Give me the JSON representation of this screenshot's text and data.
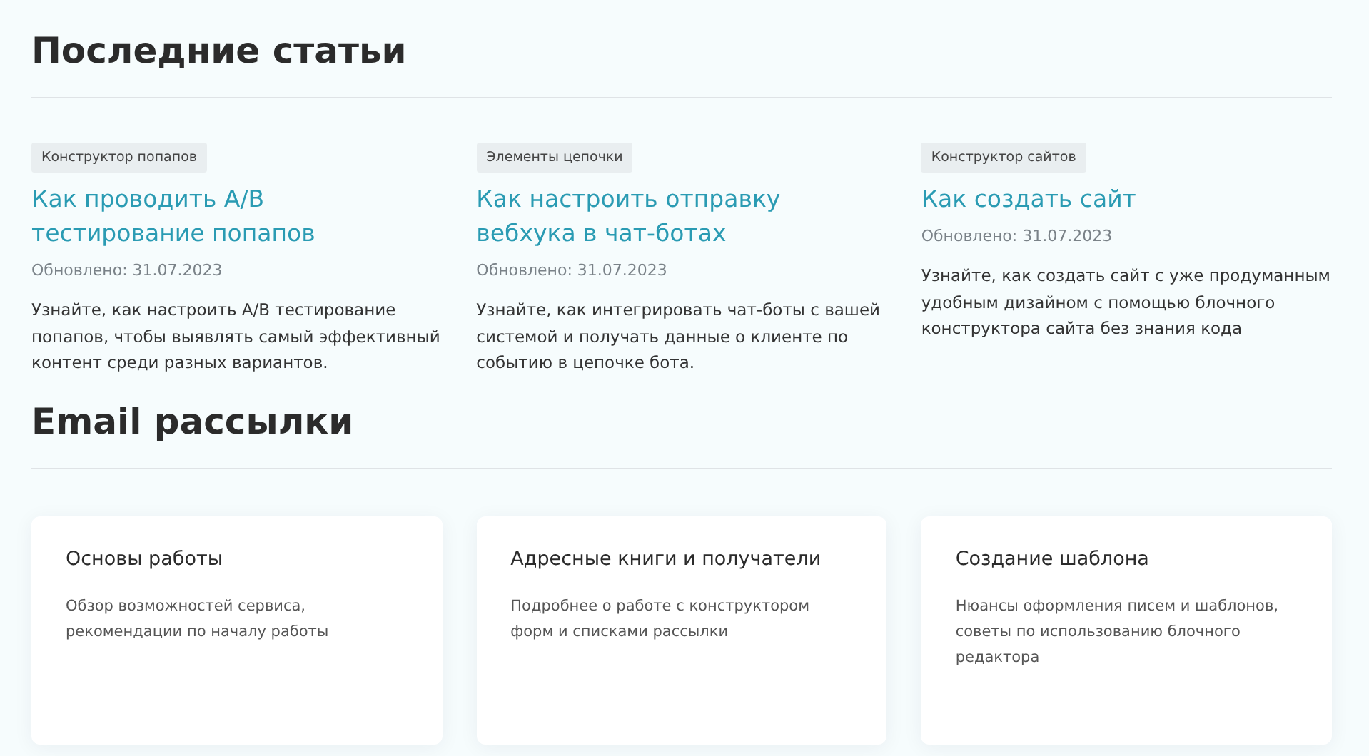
{
  "sections": [
    {
      "title": "Последние статьи",
      "kind": "articles",
      "articles": [
        {
          "tag": "Конструктор попапов",
          "title": "Как проводить A/B тестирование попапов",
          "updated": "Обновлено: 31.07.2023",
          "summary": "Узнайте, как настроить A/B тестирование попапов, чтобы выявлять самый эффективный контент среди разных вариантов."
        },
        {
          "tag": "Элементы цепочки",
          "title": "Как настроить отправку вебхука в чат-ботах",
          "updated": "Обновлено: 31.07.2023",
          "summary": "Узнайте, как интегрировать чат-боты с вашей системой и получать данные о клиенте по событию в цепочке бота."
        },
        {
          "tag": "Конструктор сайтов",
          "title": "Как создать сайт",
          "updated": "Обновлено: 31.07.2023",
          "summary": "Узнайте, как создать сайт с уже продуманным удобным дизайном с помощью блочного конструктора сайта без знания кода"
        }
      ]
    },
    {
      "title": "Email рассылки",
      "kind": "cards",
      "cards": [
        {
          "title": "Основы работы",
          "description": "Обзор возможностей сервиса, рекомендации по началу работы"
        },
        {
          "title": "Адресные книги и получатели",
          "description": "Подробнее о работе с конструктором форм и списками рассылки"
        },
        {
          "title": "Создание шаблона",
          "description": "Нюансы оформления писем и шаблонов, советы по использованию блочного редактора"
        }
      ]
    }
  ]
}
